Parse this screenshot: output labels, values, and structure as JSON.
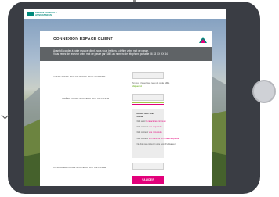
{
  "brand": {
    "name_line1": "CREDIT AGRICOLE",
    "name_line2": "ASSURANCES"
  },
  "card": {
    "title": "CONNEXION ESPACE CLIENT"
  },
  "info": {
    "line1": "Avant d'accéder à votre espace client, nous vous invitons à définir votre mot de passe.",
    "line2": "Vous venez de recevoir votre mot de passe par SMS au numéro de téléphone portable 06 33 XX XX 44"
  },
  "form": {
    "temp_password_label": "SAISIR VOTRE MOT DE PASSE REÇU PAR SMS",
    "sms_hint_line1": "Si vous n'avez pas reçu de code SMS,",
    "sms_hint_link": "cliquez ici",
    "new_password_label": "CRÉEZ VOTRE NOUVEAU MOT DE PASSE",
    "confirm_label": "CONFIRMER VOTRE NOUVEAU MOT DE PASSE",
    "submit_label": "VALIDER"
  },
  "rules": {
    "title": "VOTRE MOT DE PASSE",
    "items": [
      {
        "text": "• Doit avoir ",
        "highlight": "8 caractères minimum"
      },
      {
        "text": "• Doit contenir ",
        "highlight": "une majuscule"
      },
      {
        "text": "• Doit contenir ",
        "highlight": "une minuscule"
      },
      {
        "text": "• Doit contenir ",
        "highlight": "un chiffre ou un caractère spécial"
      },
      {
        "text": "• Ne doit pas contenir votre nom d'utilisateur",
        "highlight": ""
      }
    ]
  },
  "colors": {
    "accent": "#e2007a",
    "brand": "#00897b",
    "info_bg": "#5f6366"
  }
}
